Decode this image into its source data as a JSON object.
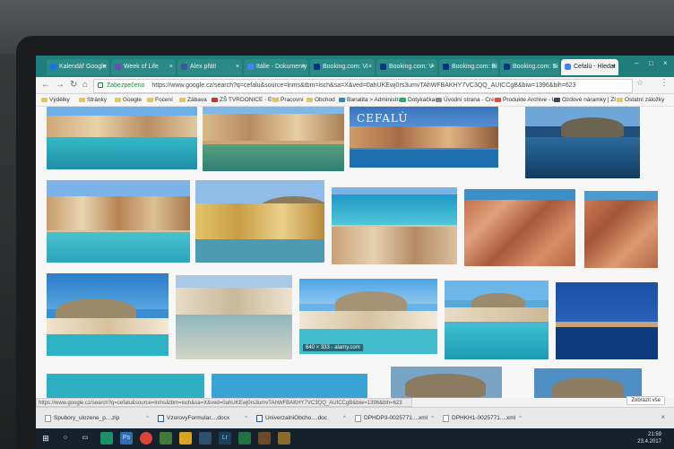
{
  "tabs": [
    {
      "label": "Kalendář Google",
      "color": "#1a73e8"
    },
    {
      "label": "Week of Life",
      "color": "#6a4fb3"
    },
    {
      "label": "Alex přát!",
      "color": "#3b5998"
    },
    {
      "label": "Itálie - Dokumenty",
      "color": "#4285f4"
    },
    {
      "label": "Booking.com: Vi",
      "color": "#003580"
    },
    {
      "label": "Booking.com: V",
      "color": "#003580"
    },
    {
      "label": "Booking.com: Bi",
      "color": "#003580"
    },
    {
      "label": "Booking.com: Si",
      "color": "#003580"
    },
    {
      "label": "Cefalù - Hledat",
      "color": "#4285f4"
    }
  ],
  "toolbar": {
    "secure_label": "Zabezpečeno",
    "url": "https://www.google.cz/search?q=cefalu&source=lnms&tbm=isch&sa=X&ved=0ahUKEwj0rs3umvTAhWFBAKHY7VC3QQ_AUICCgB&biw=1396&bih=623"
  },
  "bookmarks": [
    {
      "label": "Výdělky"
    },
    {
      "label": "Stránky"
    },
    {
      "label": "Google"
    },
    {
      "label": "Focení"
    },
    {
      "label": "Zábava"
    },
    {
      "label": "ZŠ TVRDONICE - Elek"
    },
    {
      "label": "Pracovní"
    },
    {
      "label": "Obchod"
    },
    {
      "label": "Banalita > Administra"
    },
    {
      "label": "Dotykačka"
    },
    {
      "label": "Úvodní strana - Creo"
    },
    {
      "label": "Produkte Archive - Lo"
    },
    {
      "label": "Ozdové náramky | Zl"
    },
    {
      "label": "Ostatní záložky"
    }
  ],
  "images": {
    "logo_text": "CEFALÙ",
    "caption": "640 × 333 - alamy.com"
  },
  "statusbar": {
    "url": "https://www.google.cz/search?q=cefalu&source=lnms&tbm=isch&sa=X&ved=0ahUKEwj0rs3umvTAhWFBAKHY7VC3QQ_AUICCgB&biw=1396&bih=623",
    "show_all": "Zobrazit vše"
  },
  "downloads": [
    {
      "label": "Spubory_ulozene_p....zip"
    },
    {
      "label": "VzorovyFormular....docx"
    },
    {
      "label": "UniverzalniObcho....doc"
    },
    {
      "label": "DPHDP3-0025771....xml"
    },
    {
      "label": "DPHKH1-0025771....xml"
    }
  ],
  "taskbar": {
    "time": "21:59",
    "date": "23.4.2017"
  },
  "colors": {
    "tabbar": "#1f7d7b",
    "taskbar": "#15222b",
    "sea": "#2fb6c8",
    "sky": "#5fa8e6"
  }
}
